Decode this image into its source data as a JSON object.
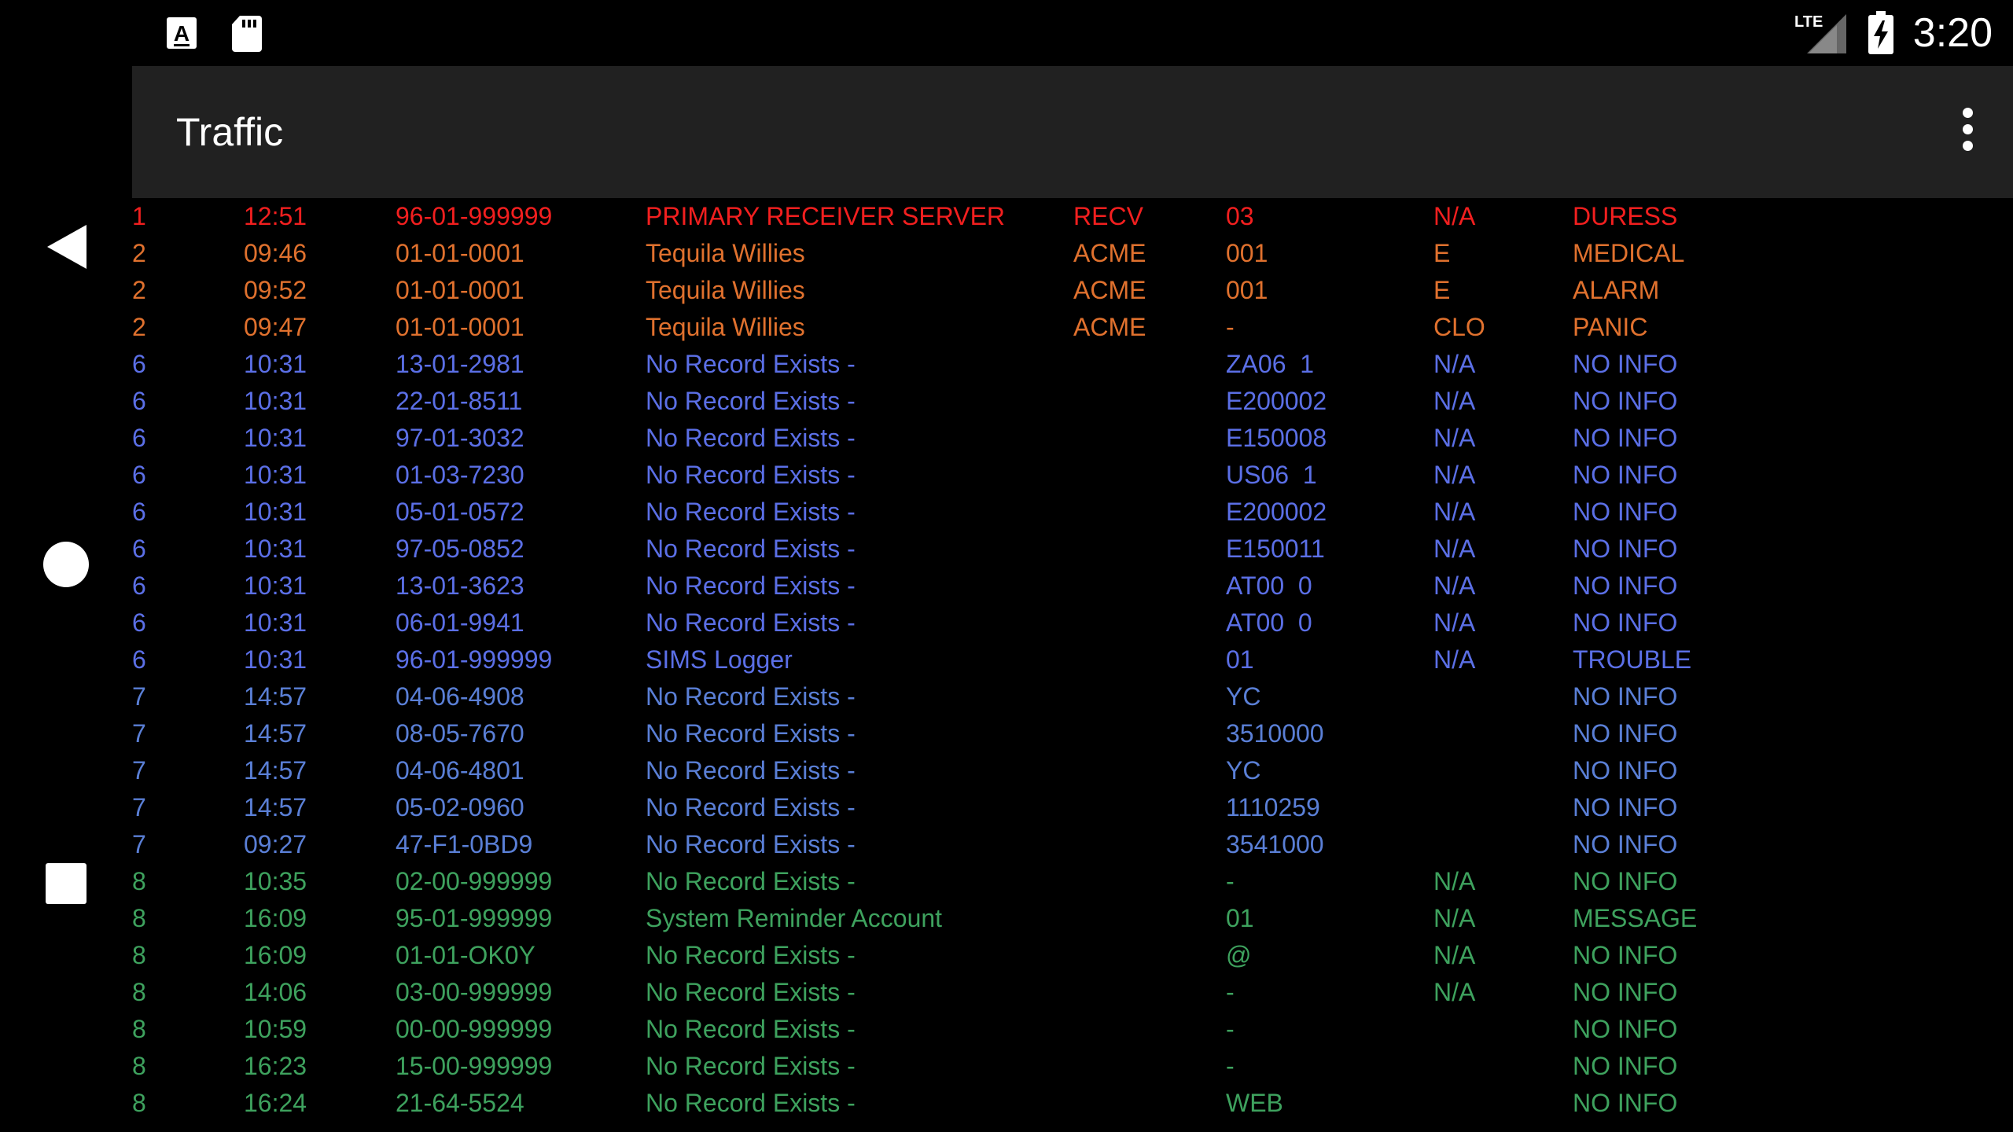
{
  "status_bar": {
    "time": "3:20",
    "network": "LTE",
    "icons": [
      "font-download-icon",
      "sd-card-icon",
      "lte-signal-icon",
      "battery-charging-icon"
    ]
  },
  "nav_bar": {
    "icons": [
      "back-icon",
      "home-icon",
      "recents-icon"
    ]
  },
  "app_bar": {
    "title": "Traffic",
    "menu_icon": "more-vert-icon"
  },
  "colors": {
    "level_1": "#f21f1f",
    "level_2": "#e0712e",
    "level_6": "#5b6fe6",
    "level_7": "#5a7fd6",
    "level_8": "#3ea25e",
    "app_bar_bg": "#212121"
  },
  "traffic": [
    {
      "level": "1",
      "time": "12:51",
      "account": "96-01-999999",
      "name": "PRIMARY RECEIVER SERVER",
      "receiver": "RECV",
      "zone": "03",
      "type": "N/A",
      "event": "DURESS"
    },
    {
      "level": "2",
      "time": "09:46",
      "account": "01-01-0001",
      "name": "Tequila Willies",
      "receiver": "ACME",
      "zone": "001",
      "type": "E",
      "event": "MEDICAL"
    },
    {
      "level": "2",
      "time": "09:52",
      "account": "01-01-0001",
      "name": "Tequila Willies",
      "receiver": "ACME",
      "zone": "001",
      "type": "E",
      "event": "ALARM"
    },
    {
      "level": "2",
      "time": "09:47",
      "account": "01-01-0001",
      "name": "Tequila Willies",
      "receiver": "ACME",
      "zone": "-",
      "type": "CLO",
      "event": "PANIC"
    },
    {
      "level": "6",
      "time": "10:31",
      "account": "13-01-2981",
      "name": "No Record Exists -",
      "receiver": "",
      "zone": "ZA06  1",
      "type": "N/A",
      "event": "NO INFO"
    },
    {
      "level": "6",
      "time": "10:31",
      "account": "22-01-8511",
      "name": "No Record Exists -",
      "receiver": "",
      "zone": "E200002",
      "type": "N/A",
      "event": "NO INFO"
    },
    {
      "level": "6",
      "time": "10:31",
      "account": "97-01-3032",
      "name": "No Record Exists -",
      "receiver": "",
      "zone": "E150008",
      "type": "N/A",
      "event": "NO INFO"
    },
    {
      "level": "6",
      "time": "10:31",
      "account": "01-03-7230",
      "name": "No Record Exists -",
      "receiver": "",
      "zone": "US06  1",
      "type": "N/A",
      "event": "NO INFO"
    },
    {
      "level": "6",
      "time": "10:31",
      "account": "05-01-0572",
      "name": "No Record Exists -",
      "receiver": "",
      "zone": "E200002",
      "type": "N/A",
      "event": "NO INFO"
    },
    {
      "level": "6",
      "time": "10:31",
      "account": "97-05-0852",
      "name": "No Record Exists -",
      "receiver": "",
      "zone": "E150011",
      "type": "N/A",
      "event": "NO INFO"
    },
    {
      "level": "6",
      "time": "10:31",
      "account": "13-01-3623",
      "name": "No Record Exists -",
      "receiver": "",
      "zone": "AT00  0",
      "type": "N/A",
      "event": "NO INFO"
    },
    {
      "level": "6",
      "time": "10:31",
      "account": "06-01-9941",
      "name": "No Record Exists -",
      "receiver": "",
      "zone": "AT00  0",
      "type": "N/A",
      "event": "NO INFO"
    },
    {
      "level": "6",
      "time": "10:31",
      "account": "96-01-999999",
      "name": "SIMS Logger",
      "receiver": "",
      "zone": "01",
      "type": "N/A",
      "event": "TROUBLE"
    },
    {
      "level": "7",
      "time": "14:57",
      "account": "04-06-4908",
      "name": "No Record Exists -",
      "receiver": "",
      "zone": "YC",
      "type": "",
      "event": "NO INFO"
    },
    {
      "level": "7",
      "time": "14:57",
      "account": "08-05-7670",
      "name": "No Record Exists -",
      "receiver": "",
      "zone": "3510000",
      "type": "",
      "event": "NO INFO"
    },
    {
      "level": "7",
      "time": "14:57",
      "account": "04-06-4801",
      "name": "No Record Exists -",
      "receiver": "",
      "zone": "YC",
      "type": "",
      "event": "NO INFO"
    },
    {
      "level": "7",
      "time": "14:57",
      "account": "05-02-0960",
      "name": "No Record Exists -",
      "receiver": "",
      "zone": "1110259",
      "type": "",
      "event": "NO INFO"
    },
    {
      "level": "7",
      "time": "09:27",
      "account": "47-F1-0BD9",
      "name": "No Record Exists -",
      "receiver": "",
      "zone": "3541000",
      "type": "",
      "event": "NO INFO"
    },
    {
      "level": "8",
      "time": "10:35",
      "account": "02-00-999999",
      "name": "No Record Exists -",
      "receiver": "",
      "zone": "-",
      "type": "N/A",
      "event": "NO INFO"
    },
    {
      "level": "8",
      "time": "16:09",
      "account": "95-01-999999",
      "name": "System Reminder Account",
      "receiver": "",
      "zone": "01",
      "type": "N/A",
      "event": "MESSAGE"
    },
    {
      "level": "8",
      "time": "16:09",
      "account": "01-01-OK0Y",
      "name": "No Record Exists -",
      "receiver": "",
      "zone": "@",
      "type": "N/A",
      "event": "NO INFO"
    },
    {
      "level": "8",
      "time": "14:06",
      "account": "03-00-999999",
      "name": "No Record Exists -",
      "receiver": "",
      "zone": "-",
      "type": "N/A",
      "event": "NO INFO"
    },
    {
      "level": "8",
      "time": "10:59",
      "account": "00-00-999999",
      "name": "No Record Exists -",
      "receiver": "",
      "zone": "-",
      "type": "",
      "event": "NO INFO"
    },
    {
      "level": "8",
      "time": "16:23",
      "account": "15-00-999999",
      "name": "No Record Exists -",
      "receiver": "",
      "zone": "-",
      "type": "",
      "event": "NO INFO"
    },
    {
      "level": "8",
      "time": "16:24",
      "account": "21-64-5524",
      "name": "No Record Exists -",
      "receiver": "",
      "zone": "WEB",
      "type": "",
      "event": "NO INFO"
    }
  ]
}
